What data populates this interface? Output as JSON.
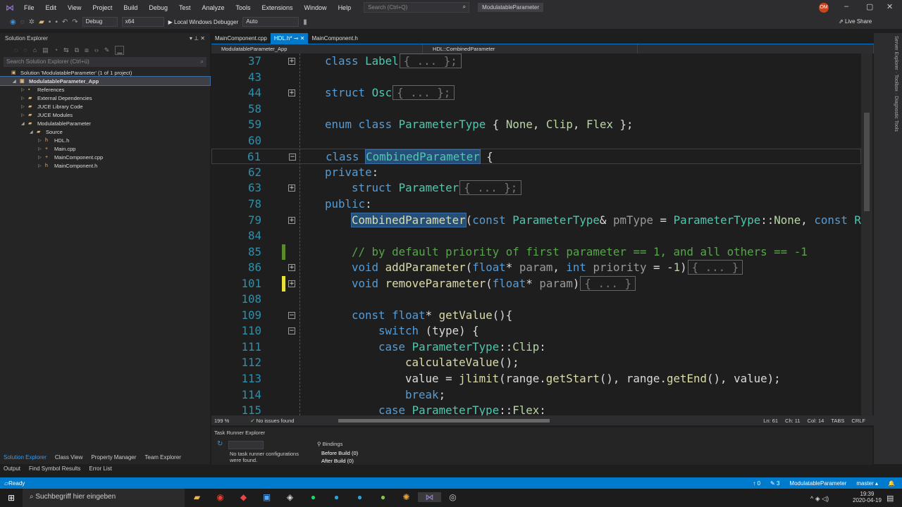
{
  "title_bar": {
    "menus": [
      "File",
      "Edit",
      "View",
      "Project",
      "Build",
      "Debug",
      "Test",
      "Analyze",
      "Tools",
      "Extensions",
      "Window",
      "Help"
    ],
    "search_placeholder": "Search (Ctrl+Q)",
    "project": "ModulatableParameter",
    "avatar": "OM"
  },
  "toolbar": {
    "config": "Debug",
    "platform": "x64",
    "run": "▶ Local Windows Debugger",
    "run_mode": "Auto",
    "live_share": "Live Share"
  },
  "solution_explorer": {
    "title": "Solution Explorer",
    "search_placeholder": "Search Solution Explorer (Ctrl+ü)",
    "items": [
      {
        "label": "Solution 'ModulatableParameter' (1 of 1 project)",
        "depth": 0,
        "tw": "",
        "icon": "▣"
      },
      {
        "label": "ModulatableParameter_App",
        "depth": 1,
        "tw": "◢",
        "icon": "▣",
        "selected": true
      },
      {
        "label": "References",
        "depth": 2,
        "tw": "▷",
        "icon": "▪"
      },
      {
        "label": "External Dependencies",
        "depth": 2,
        "tw": "▷",
        "icon": "▰"
      },
      {
        "label": "JUCE Library Code",
        "depth": 2,
        "tw": "▷",
        "icon": "▰"
      },
      {
        "label": "JUCE Modules",
        "depth": 2,
        "tw": "▷",
        "icon": "▰"
      },
      {
        "label": "ModulatableParameter",
        "depth": 2,
        "tw": "◢",
        "icon": "▰"
      },
      {
        "label": "Source",
        "depth": 3,
        "tw": "◢",
        "icon": "▰"
      },
      {
        "label": "HDL.h",
        "depth": 4,
        "tw": "▷",
        "icon": "h"
      },
      {
        "label": "Main.cpp",
        "depth": 4,
        "tw": "▷",
        "icon": "+"
      },
      {
        "label": "MainComponent.cpp",
        "depth": 4,
        "tw": "▷",
        "icon": "+"
      },
      {
        "label": "MainComponent.h",
        "depth": 4,
        "tw": "▷",
        "icon": "h"
      }
    ]
  },
  "bottom_tabs_left": [
    "Solution Explorer",
    "Class View",
    "Property Manager",
    "Team Explorer"
  ],
  "bottom_tabs_left2": [
    "Output",
    "Find Symbol Results",
    "Error List"
  ],
  "editor": {
    "tabs": [
      {
        "label": "MainComponent.cpp"
      },
      {
        "label": "HDL.h* ⊸ ✕",
        "active": true
      },
      {
        "label": "MainComponent.h"
      }
    ],
    "nav": [
      "ModulatableParameter_App",
      "HDL::CombinedParameter",
      ""
    ],
    "lines": [
      {
        "n": "37",
        "i": 0,
        "f": "+",
        "t": [
          [
            "class ",
            "kw"
          ],
          [
            "Label",
            "type"
          ],
          [
            "{ ... };",
            "box"
          ]
        ]
      },
      {
        "n": "43",
        "i": 0,
        "t": []
      },
      {
        "n": "44",
        "i": 0,
        "f": "+",
        "t": [
          [
            "struct ",
            "kw"
          ],
          [
            "Osc",
            "type"
          ],
          [
            "{ ... };",
            "box"
          ]
        ]
      },
      {
        "n": "58",
        "i": 0,
        "t": []
      },
      {
        "n": "59",
        "i": 0,
        "t": [
          [
            "enum class ",
            "kw"
          ],
          [
            "ParameterType",
            "type"
          ],
          [
            " { ",
            "txt"
          ],
          [
            "None",
            "enum"
          ],
          [
            ", ",
            "txt"
          ],
          [
            "Clip",
            "enum"
          ],
          [
            ", ",
            "txt"
          ],
          [
            "Flex",
            "enum"
          ],
          [
            " };",
            "txt"
          ]
        ]
      },
      {
        "n": "60",
        "i": 0,
        "t": []
      },
      {
        "n": "61",
        "i": 0,
        "f": "−",
        "cur": true,
        "t": [
          [
            "class ",
            "kw"
          ],
          [
            "CombinedParameter",
            "type sel"
          ],
          [
            " {",
            "txt"
          ]
        ]
      },
      {
        "n": "62",
        "i": 0,
        "t": [
          [
            "private",
            "kw"
          ],
          [
            ":",
            "txt"
          ]
        ]
      },
      {
        "n": "63",
        "i": 1,
        "f": "+",
        "t": [
          [
            "struct ",
            "kw"
          ],
          [
            "Parameter",
            "type"
          ],
          [
            "{ ... };",
            "box"
          ]
        ]
      },
      {
        "n": "78",
        "i": 0,
        "t": [
          [
            "public",
            "kw"
          ],
          [
            ":",
            "txt"
          ]
        ]
      },
      {
        "n": "79",
        "i": 1,
        "f": "+",
        "t": [
          [
            "CombinedParameter",
            "fn sel"
          ],
          [
            "(",
            "txt"
          ],
          [
            "const ",
            "kw"
          ],
          [
            "ParameterType",
            "type"
          ],
          [
            "& ",
            "txt"
          ],
          [
            "pmType",
            "param"
          ],
          [
            " = ",
            "txt"
          ],
          [
            "ParameterType",
            "type"
          ],
          [
            "::",
            "txt"
          ],
          [
            "None",
            "enum"
          ],
          [
            ", ",
            "txt"
          ],
          [
            "const ",
            "kw"
          ],
          [
            "Ra",
            "type"
          ]
        ]
      },
      {
        "n": "84",
        "i": 0,
        "t": []
      },
      {
        "n": "85",
        "i": 1,
        "chg": "#5a8a2a",
        "t": [
          [
            "// by default priority of first parameter == 1, and all others == -1",
            "cm"
          ]
        ]
      },
      {
        "n": "86",
        "i": 1,
        "f": "+",
        "t": [
          [
            "void ",
            "kw"
          ],
          [
            "addParameter",
            "fn"
          ],
          [
            "(",
            "txt"
          ],
          [
            "float",
            "kw"
          ],
          [
            "* ",
            "txt"
          ],
          [
            "param",
            "param"
          ],
          [
            ", ",
            "txt"
          ],
          [
            "int ",
            "kw"
          ],
          [
            "priority",
            "param"
          ],
          [
            " = -",
            "txt"
          ],
          [
            "1",
            "num"
          ],
          [
            ")",
            "txt"
          ],
          [
            "{ ... }",
            "box"
          ]
        ]
      },
      {
        "n": "101",
        "i": 1,
        "f": "+",
        "chg": "#e8e03a",
        "t": [
          [
            "void ",
            "kw"
          ],
          [
            "removeParameter",
            "fn"
          ],
          [
            "(",
            "txt"
          ],
          [
            "float",
            "kw"
          ],
          [
            "* ",
            "txt"
          ],
          [
            "param",
            "param"
          ],
          [
            ")",
            "txt"
          ],
          [
            "{ ... }",
            "box"
          ]
        ]
      },
      {
        "n": "108",
        "i": 0,
        "t": []
      },
      {
        "n": "109",
        "i": 1,
        "f": "−",
        "t": [
          [
            "const ",
            "kw"
          ],
          [
            "float",
            "kw"
          ],
          [
            "* ",
            "txt"
          ],
          [
            "getValue",
            "fn"
          ],
          [
            "(){",
            "txt"
          ]
        ]
      },
      {
        "n": "110",
        "i": 2,
        "f": "−",
        "t": [
          [
            "switch",
            "kw"
          ],
          [
            " (type) {",
            "txt"
          ]
        ]
      },
      {
        "n": "111",
        "i": 2,
        "t": [
          [
            "case ",
            "kw"
          ],
          [
            "ParameterType",
            "type"
          ],
          [
            "::",
            "txt"
          ],
          [
            "Clip",
            "enum"
          ],
          [
            ":",
            "txt"
          ]
        ]
      },
      {
        "n": "112",
        "i": 3,
        "t": [
          [
            "calculateValue",
            "fn"
          ],
          [
            "();",
            "txt"
          ]
        ]
      },
      {
        "n": "113",
        "i": 3,
        "t": [
          [
            "value = ",
            "txt"
          ],
          [
            "jlimit",
            "fn"
          ],
          [
            "(range.",
            "txt"
          ],
          [
            "getStart",
            "fn"
          ],
          [
            "(), range.",
            "txt"
          ],
          [
            "getEnd",
            "fn"
          ],
          [
            "(), value);",
            "txt"
          ]
        ]
      },
      {
        "n": "114",
        "i": 3,
        "t": [
          [
            "break",
            "kw"
          ],
          [
            ";",
            "txt"
          ]
        ]
      },
      {
        "n": "115",
        "i": 2,
        "t": [
          [
            "case ",
            "kw"
          ],
          [
            "ParameterType",
            "type"
          ],
          [
            "::",
            "txt"
          ],
          [
            "Flex",
            "enum"
          ],
          [
            ":",
            "txt"
          ]
        ]
      }
    ]
  },
  "editor_status": {
    "zoom": "199 %",
    "issues": "No issues found",
    "ln": "Ln: 61",
    "ch": "Ch: 11",
    "col": "Col: 14",
    "tabs": "TABS",
    "eol": "CRLF"
  },
  "task_runner": {
    "title": "Task Runner Explorer",
    "bindings": "Bindings",
    "empty": "No task runner configurations were found.",
    "before": "Before Build (0)",
    "after": "After Build (0)"
  },
  "status_bar": {
    "ready": "Ready",
    "up": "↑ 0",
    "edits": "✎ 3",
    "repo": "ModulatableParameter",
    "branch": "master ▴"
  },
  "taskbar": {
    "search": "Suchbegriff hier eingeben",
    "time": "19:39",
    "date": "2020-04-19"
  },
  "colors": {
    "accent": "#007acc",
    "editor_bg": "#1e1e1e"
  }
}
